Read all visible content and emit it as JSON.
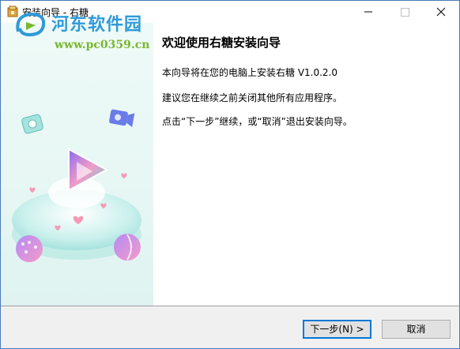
{
  "window": {
    "title": "安装向导 - 右糖",
    "accent": "#0078d7"
  },
  "watermark": {
    "name": "河东软件园",
    "url": "www.pc0359.cn"
  },
  "content": {
    "heading": "欢迎使用右糖安装向导",
    "paragraphs": [
      "本向导将在您的电脑上安装右糖 V1.0.2.0",
      "建议您在继续之前关闭其他所有应用程序。",
      "点击“下一步”继续，或“取消”退出安装向导。"
    ]
  },
  "buttons": {
    "next": "下一步(N) >",
    "cancel": "取消"
  },
  "icons": {
    "app": "installer-icon",
    "minimize": "minimize-icon",
    "maximize": "maximize-icon",
    "close": "close-icon"
  }
}
